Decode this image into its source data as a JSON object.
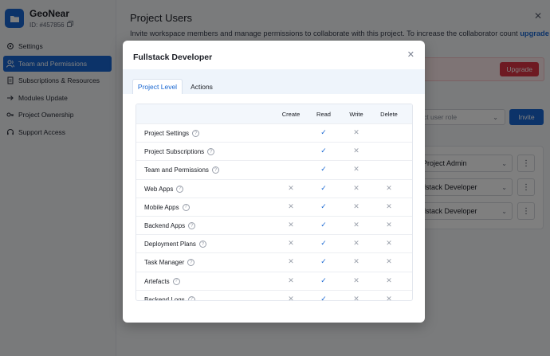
{
  "sidebar": {
    "project_name": "GeoNear",
    "project_id": "ID: #457856",
    "items": [
      {
        "label": "Settings",
        "icon": "gear-icon",
        "active": false
      },
      {
        "label": "Team and Permissions",
        "icon": "users-icon",
        "active": true
      },
      {
        "label": "Subscriptions & Resources",
        "icon": "document-icon",
        "active": false
      },
      {
        "label": "Modules Update",
        "icon": "arrow-right-icon",
        "active": false
      },
      {
        "label": "Project Ownership",
        "icon": "key-icon",
        "active": false
      },
      {
        "label": "Support Access",
        "icon": "headset-icon",
        "active": false
      }
    ]
  },
  "main": {
    "title": "Project Users",
    "description": "Invite workspace members and manage permissions to collaborate with this project. To increase the collaborator count",
    "description_link": "upgrade",
    "upgrade_label": "Upgrade",
    "role_placeholder": "ct user role",
    "invite_label": "Invite",
    "user_roles": [
      "Project Admin",
      "llstack Developer",
      "llstack Developer"
    ]
  },
  "modal": {
    "title": "Fullstack Developer",
    "tabs": [
      {
        "label": "Project Level",
        "active": true
      },
      {
        "label": "Actions",
        "active": false
      }
    ],
    "columns": [
      "Create",
      "Read",
      "Write",
      "Delete"
    ],
    "rows": [
      {
        "label": "Project Settings",
        "create": null,
        "read": "check",
        "write": "x",
        "delete": null
      },
      {
        "label": "Project Subscriptions",
        "create": null,
        "read": "check",
        "write": "x",
        "delete": null
      },
      {
        "label": "Team and Permissions",
        "create": null,
        "read": "check",
        "write": "x",
        "delete": null
      },
      {
        "label": "Web Apps",
        "create": "x",
        "read": "check",
        "write": "x",
        "delete": "x"
      },
      {
        "label": "Mobile Apps",
        "create": "x",
        "read": "check",
        "write": "x",
        "delete": "x"
      },
      {
        "label": "Backend Apps",
        "create": "x",
        "read": "check",
        "write": "x",
        "delete": "x"
      },
      {
        "label": "Deployment Plans",
        "create": "x",
        "read": "check",
        "write": "x",
        "delete": "x"
      },
      {
        "label": "Task Manager",
        "create": "x",
        "read": "check",
        "write": "x",
        "delete": "x"
      },
      {
        "label": "Artefacts",
        "create": "x",
        "read": "check",
        "write": "x",
        "delete": "x"
      },
      {
        "label": "Backend Logs",
        "create": "x",
        "read": "check",
        "write": "x",
        "delete": "x"
      }
    ]
  },
  "colors": {
    "accent": "#1967d2",
    "danger": "#dc3545"
  }
}
